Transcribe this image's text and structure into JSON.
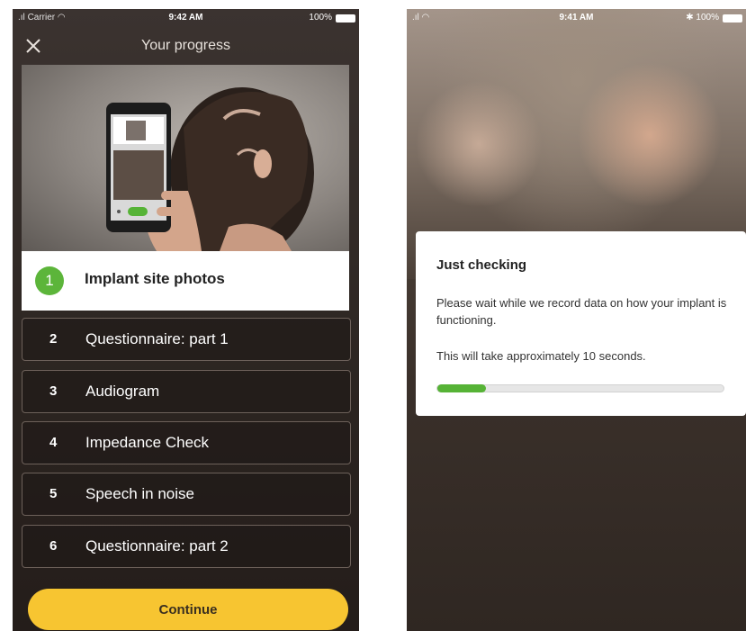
{
  "left_screen": {
    "status": {
      "carrier": "Carrier",
      "time": "9:42 AM",
      "battery": "100%"
    },
    "nav": {
      "title": "Your progress",
      "close_icon": "close-icon"
    },
    "active_step": {
      "number": "1",
      "label": "Implant site photos"
    },
    "steps": [
      {
        "number": "2",
        "label": "Questionnaire: part 1"
      },
      {
        "number": "3",
        "label": "Audiogram"
      },
      {
        "number": "4",
        "label": "Impedance Check"
      },
      {
        "number": "5",
        "label": "Speech in noise"
      },
      {
        "number": "6",
        "label": "Questionnaire: part 2"
      }
    ],
    "continue_label": "Continue",
    "colors": {
      "accent": "#f7c531",
      "active_circle": "#5cb53a"
    }
  },
  "right_screen": {
    "status": {
      "time": "9:41 AM",
      "battery": "100%"
    },
    "dialog": {
      "title": "Just checking",
      "message": "Please wait while we record data on how your implant is functioning.",
      "duration_text": "This will take approximately 10 seconds.",
      "progress": 0.17
    },
    "colors": {
      "progress": "#56b336"
    }
  }
}
